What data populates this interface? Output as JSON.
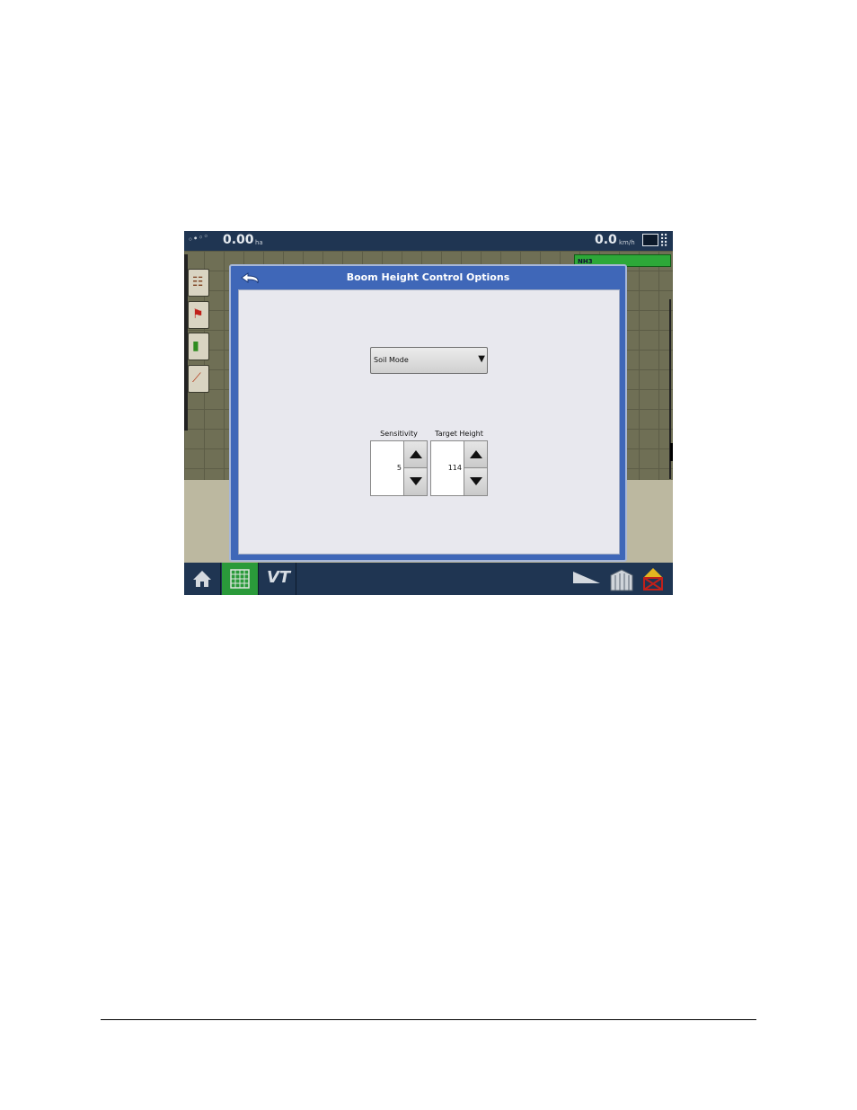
{
  "status_bar": {
    "gps_icon": "satellite-icon",
    "area_value": "0.00",
    "area_unit": "ha",
    "speed_value": "0.0",
    "speed_unit": "km/h"
  },
  "product_tab": {
    "label": "NH3",
    "color": "#2da838"
  },
  "left_tabs": [
    {
      "icon": "layers-legend-icon"
    },
    {
      "icon": "flag-icon"
    },
    {
      "icon": "bar-chart-icon"
    },
    {
      "icon": "guidance-icon"
    }
  ],
  "dialog": {
    "title": "Boom Height Control Options",
    "mode_select": {
      "value": "Soil Mode"
    },
    "sensitivity": {
      "label": "Sensitivity",
      "value": "5"
    },
    "target_height": {
      "label": "Target Height",
      "value": "114"
    }
  },
  "bottom_bar": {
    "home_icon": "home-icon",
    "map_icon": "grid-map-icon",
    "vt_label": "VT",
    "colors": {
      "bar": "#1f3552",
      "active": "#2a9a3a"
    }
  }
}
